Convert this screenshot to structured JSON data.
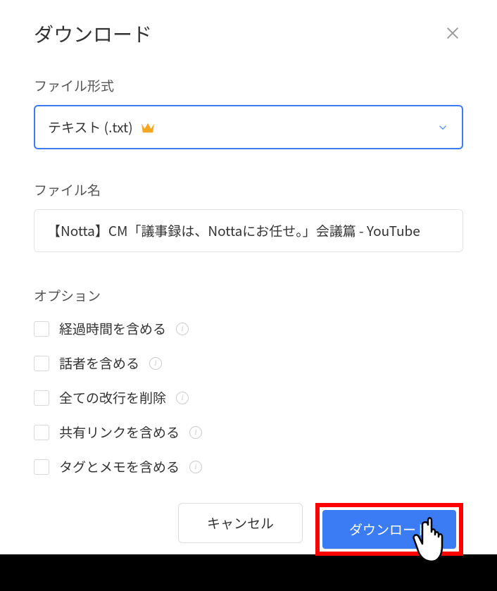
{
  "modal": {
    "title": "ダウンロード",
    "fileFormat": {
      "label": "ファイル形式",
      "value": "テキスト (.txt)"
    },
    "fileName": {
      "label": "ファイル名",
      "value": "【Notta】CM「議事録は、Nottaにお任せ。」会議篇 - YouTube"
    },
    "options": {
      "label": "オプション",
      "items": [
        {
          "label": "経過時間を含める"
        },
        {
          "label": "話者を含める"
        },
        {
          "label": "全ての改行を削除"
        },
        {
          "label": "共有リンクを含める"
        },
        {
          "label": "タグとメモを含める"
        }
      ]
    },
    "buttons": {
      "cancel": "キャンセル",
      "download": "ダウンロード"
    }
  }
}
